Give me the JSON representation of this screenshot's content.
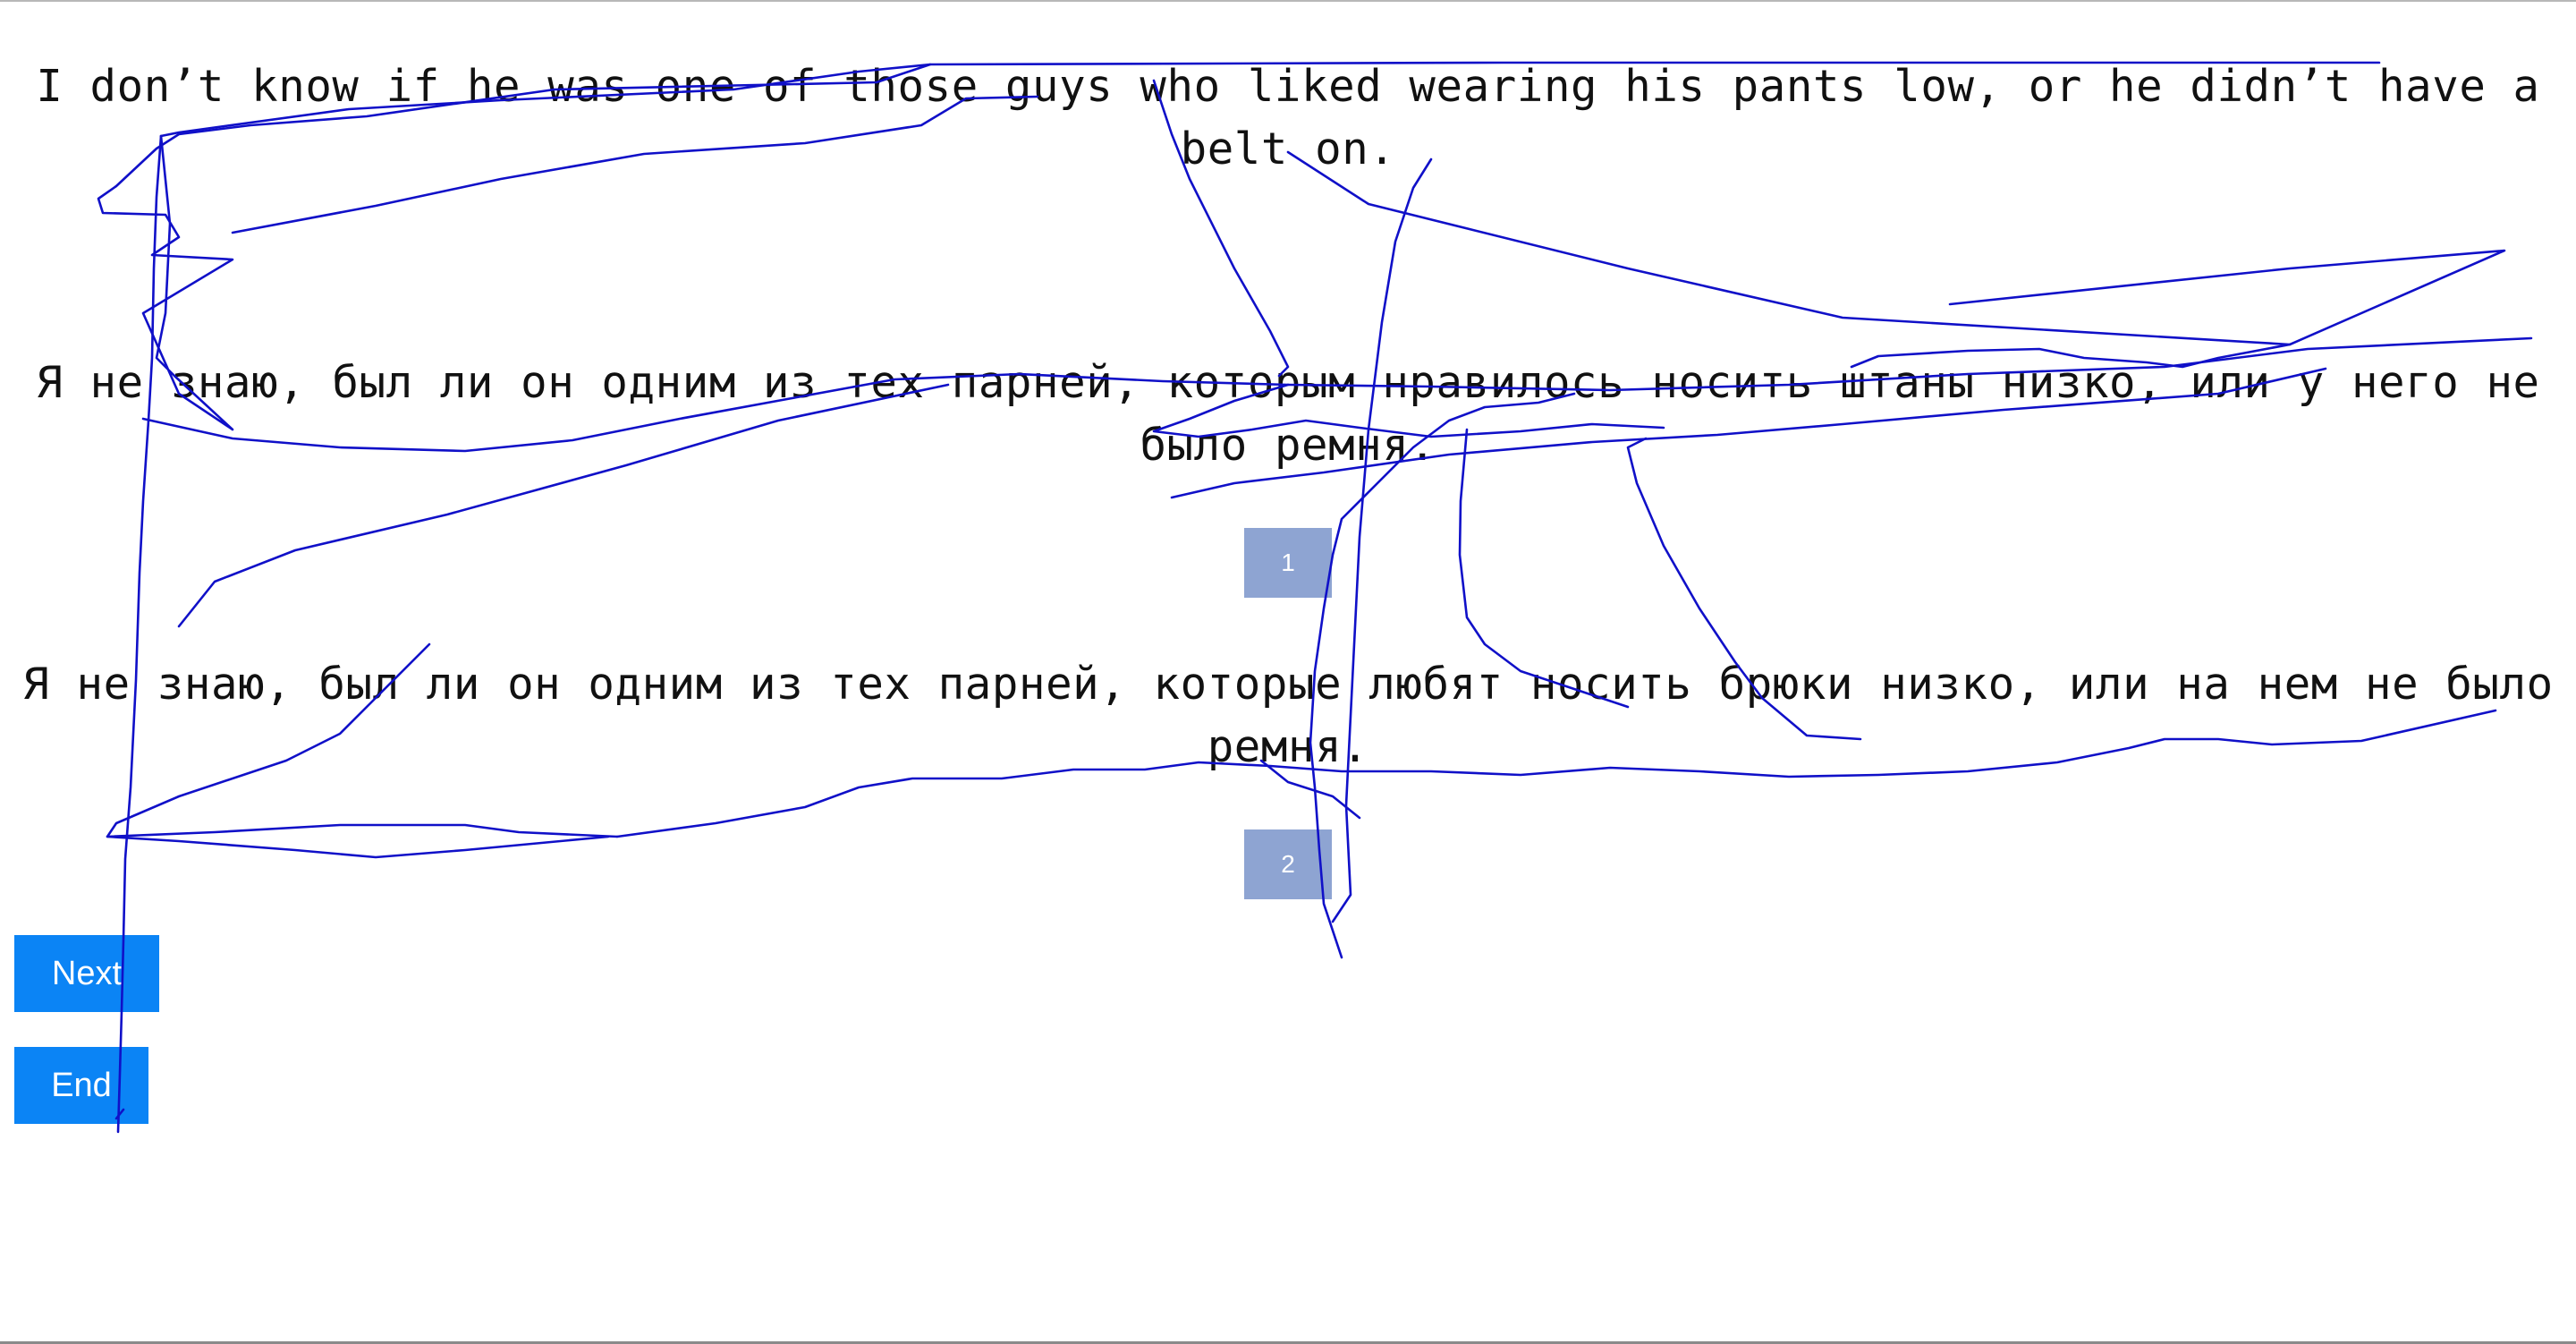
{
  "source_sentence": "I don’t know if he was one of those guys who liked wearing his pants low, or he didn’t have a belt on.",
  "translations": [
    {
      "text": "Я не знаю, был ли он одним из тех парней, которым нравилось носить штаны низко, или у него не было ремня.",
      "button_label": "1"
    },
    {
      "text": "Я не знаю, был ли он одним из тех парней, которые любят носить брюки низко, или на нем не было ремня.",
      "button_label": "2"
    }
  ],
  "buttons": {
    "next_label": "Next",
    "end_label": "End"
  },
  "colors": {
    "choice_button": "#8ea4d2",
    "nav_button": "#0b84f5",
    "scribble_stroke": "#1010c8"
  }
}
